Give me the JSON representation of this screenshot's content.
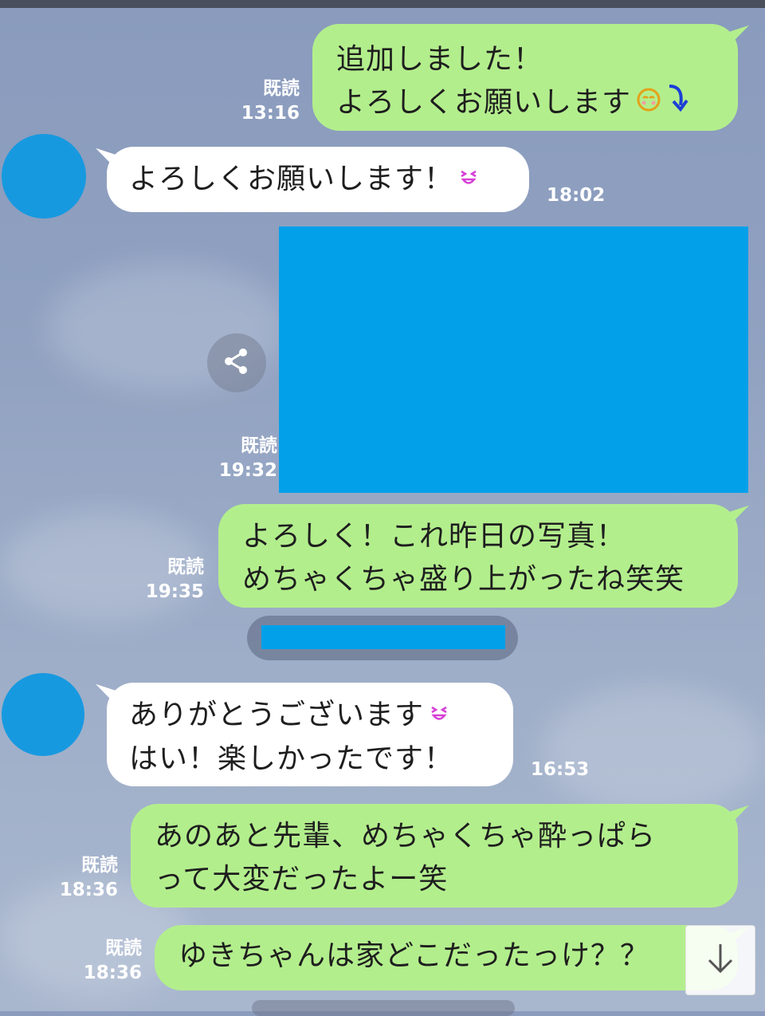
{
  "messages": [
    {
      "lines": [
        "追加しました！",
        "よろしくお願いします"
      ],
      "read": "既読",
      "time": "13:16"
    },
    {
      "lines": [
        "よろしくお願いします！"
      ],
      "time": "18:02"
    },
    {
      "read": "既読",
      "time": "19:32"
    },
    {
      "lines": [
        "よろしく！これ昨日の写真！",
        "めちゃくちゃ盛り上がったね笑笑"
      ],
      "read": "既読",
      "time": "19:35"
    },
    {
      "lines": [
        "ありがとうございます",
        "はい！楽しかったです！"
      ],
      "time": "16:53"
    },
    {
      "lines": [
        "あのあと先輩、めちゃくちゃ酔っぱら",
        "って大変だったよー笑"
      ],
      "read": "既読",
      "time": "18:36"
    },
    {
      "lines": [
        "ゆきちゃんは家どこだったっけ？？"
      ],
      "read": "既読",
      "time": "18:36"
    }
  ],
  "icons": {
    "share": "share-icon",
    "scroll_down": "arrow-down-icon",
    "blushing": "blushing-face-icon",
    "arrow": "curved-arrow-icon",
    "happy": "happy-face-icon"
  },
  "colors": {
    "outgoing_bubble": "#b3ee8d",
    "incoming_bubble": "#ffffff",
    "redaction": "#03a0ea"
  }
}
